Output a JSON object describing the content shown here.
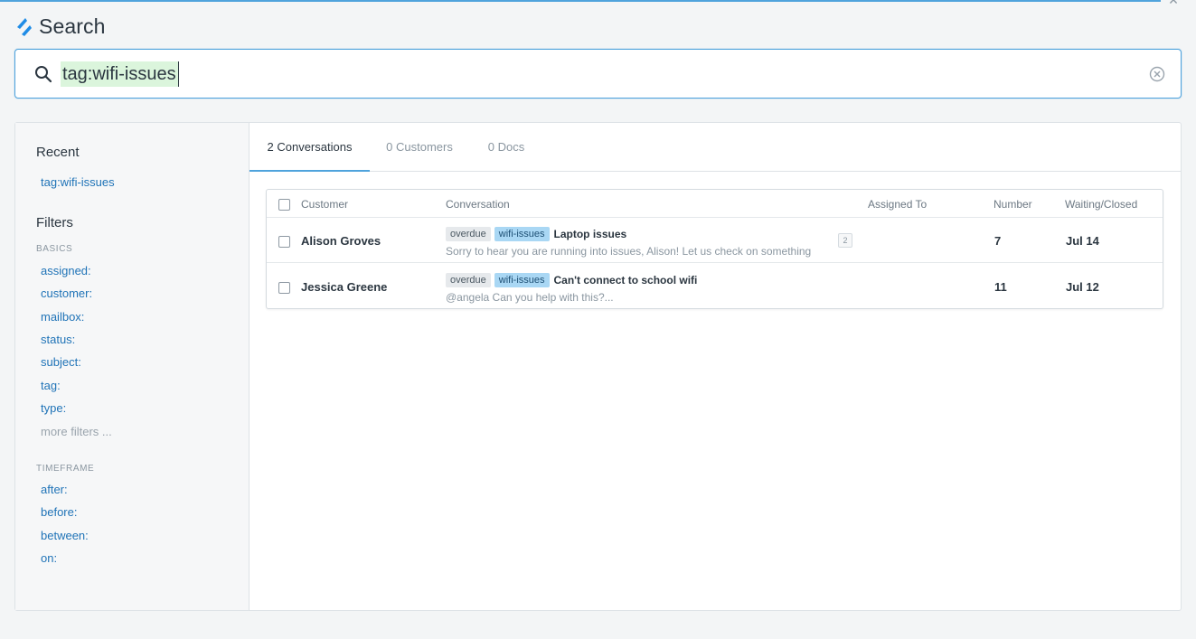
{
  "header": {
    "title": "Search",
    "close_label": "×"
  },
  "search": {
    "query": "tag:wifi-issues"
  },
  "sidebar": {
    "recent_heading": "Recent",
    "recent_items": [
      "tag:wifi-issues"
    ],
    "filters_heading": "Filters",
    "basics_label": "BASICS",
    "basics": [
      "assigned:",
      "customer:",
      "mailbox:",
      "status:",
      "subject:",
      "tag:",
      "type:"
    ],
    "more_filters": "more filters ...",
    "timeframe_label": "TIMEFRAME",
    "timeframe": [
      "after:",
      "before:",
      "between:",
      "on:"
    ]
  },
  "tabs": [
    {
      "label": "2 Conversations",
      "active": true
    },
    {
      "label": "0 Customers",
      "active": false
    },
    {
      "label": "0 Docs",
      "active": false
    }
  ],
  "table": {
    "columns": [
      "Customer",
      "Conversation",
      "Assigned To",
      "Number",
      "Waiting/Closed"
    ],
    "rows": [
      {
        "customer": "Alison Groves",
        "tags": [
          "overdue",
          "wifi-issues"
        ],
        "subject": "Laptop issues",
        "preview": "Sorry to hear you are running into issues, Alison! Let us check on something",
        "thread_count": "2",
        "assigned_to": "",
        "number": "7",
        "date": "Jul 14"
      },
      {
        "customer": "Jessica Greene",
        "tags": [
          "overdue",
          "wifi-issues"
        ],
        "subject": "Can't connect to school wifi",
        "preview": "@angela Can you help with this?...",
        "thread_count": "",
        "assigned_to": "",
        "number": "11",
        "date": "Jul 12"
      }
    ]
  },
  "colors": {
    "accent": "#4fa3dc",
    "link": "#1f73b7",
    "tag_blue": "#a9d7f4",
    "tag_grey": "#e6e9ec",
    "token_bg": "#dbf5dc"
  },
  "icons": {
    "logo": "helpscout-logo",
    "search": "search-icon",
    "clear": "clear-circle-icon",
    "close": "close-icon"
  }
}
